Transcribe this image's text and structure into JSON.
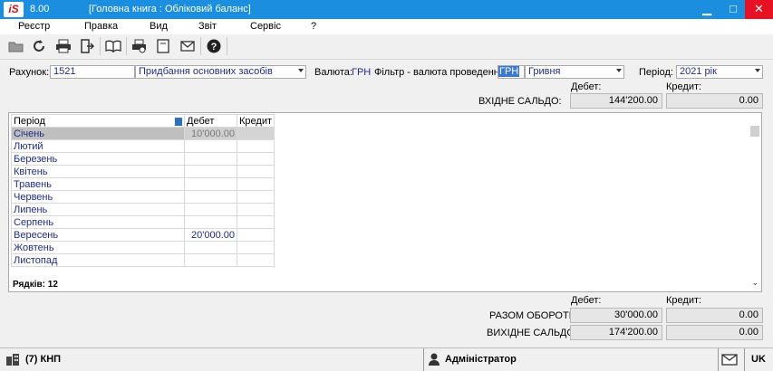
{
  "app": {
    "logo_text": "iS",
    "version": "8.00",
    "window_title": "[Головна книга : Обліковий баланс]",
    "minimize": "▁",
    "maximize": "□",
    "close": "✕"
  },
  "menu": [
    "Реєстр",
    "Правка",
    "Вид",
    "Звіт",
    "Сервіс",
    "?"
  ],
  "toolbar": {
    "icons": [
      "folder-open-icon",
      "refresh-icon",
      "print-icon",
      "exit-icon",
      "book-icon",
      "print-preview-icon",
      "document-icon",
      "mail-icon",
      "help-icon"
    ]
  },
  "form": {
    "account_label": "Рахунок:",
    "account_code": "1521",
    "account_name": "Придбання основних засобів",
    "currency_label": "Валюта:",
    "currency_value": "ГРН",
    "filter_label": "Фільтр - валюта проведення:",
    "filter_code": "ГРН",
    "filter_name": "Гривня",
    "period_label": "Період:",
    "period_value": "2021 рік"
  },
  "opening": {
    "debit_header": "Дебет:",
    "credit_header": "Кредит:",
    "label": "ВХІДНЕ САЛЬДО:",
    "debit": "144'200.00",
    "credit": "0.00"
  },
  "grid": {
    "columns": [
      "Період",
      "Дебет",
      "Кредит"
    ],
    "rows": [
      {
        "period": "Січень",
        "debit": "10'000.00",
        "credit": ""
      },
      {
        "period": "Лютий",
        "debit": "",
        "credit": ""
      },
      {
        "period": "Березень",
        "debit": "",
        "credit": ""
      },
      {
        "period": "Квітень",
        "debit": "",
        "credit": ""
      },
      {
        "period": "Травень",
        "debit": "",
        "credit": ""
      },
      {
        "period": "Червень",
        "debit": "",
        "credit": ""
      },
      {
        "period": "Липень",
        "debit": "",
        "credit": ""
      },
      {
        "period": "Серпень",
        "debit": "",
        "credit": ""
      },
      {
        "period": "Вересень",
        "debit": "20'000.00",
        "credit": ""
      },
      {
        "period": "Жовтень",
        "debit": "",
        "credit": ""
      },
      {
        "period": "Листопад",
        "debit": "",
        "credit": ""
      }
    ],
    "rows_count": "Рядків: 12"
  },
  "totals": {
    "debit_header": "Дебет:",
    "credit_header": "Кредит:",
    "turnover_label": "РАЗОМ ОБОРОТИ:",
    "turnover_debit": "30'000.00",
    "turnover_credit": "0.00",
    "closing_label": "ВИХІДНЕ САЛЬДО:",
    "closing_debit": "174'200.00",
    "closing_credit": "0.00"
  },
  "status": {
    "company": "(7) КНП",
    "user": "Адміністратор",
    "lang": "UK"
  }
}
